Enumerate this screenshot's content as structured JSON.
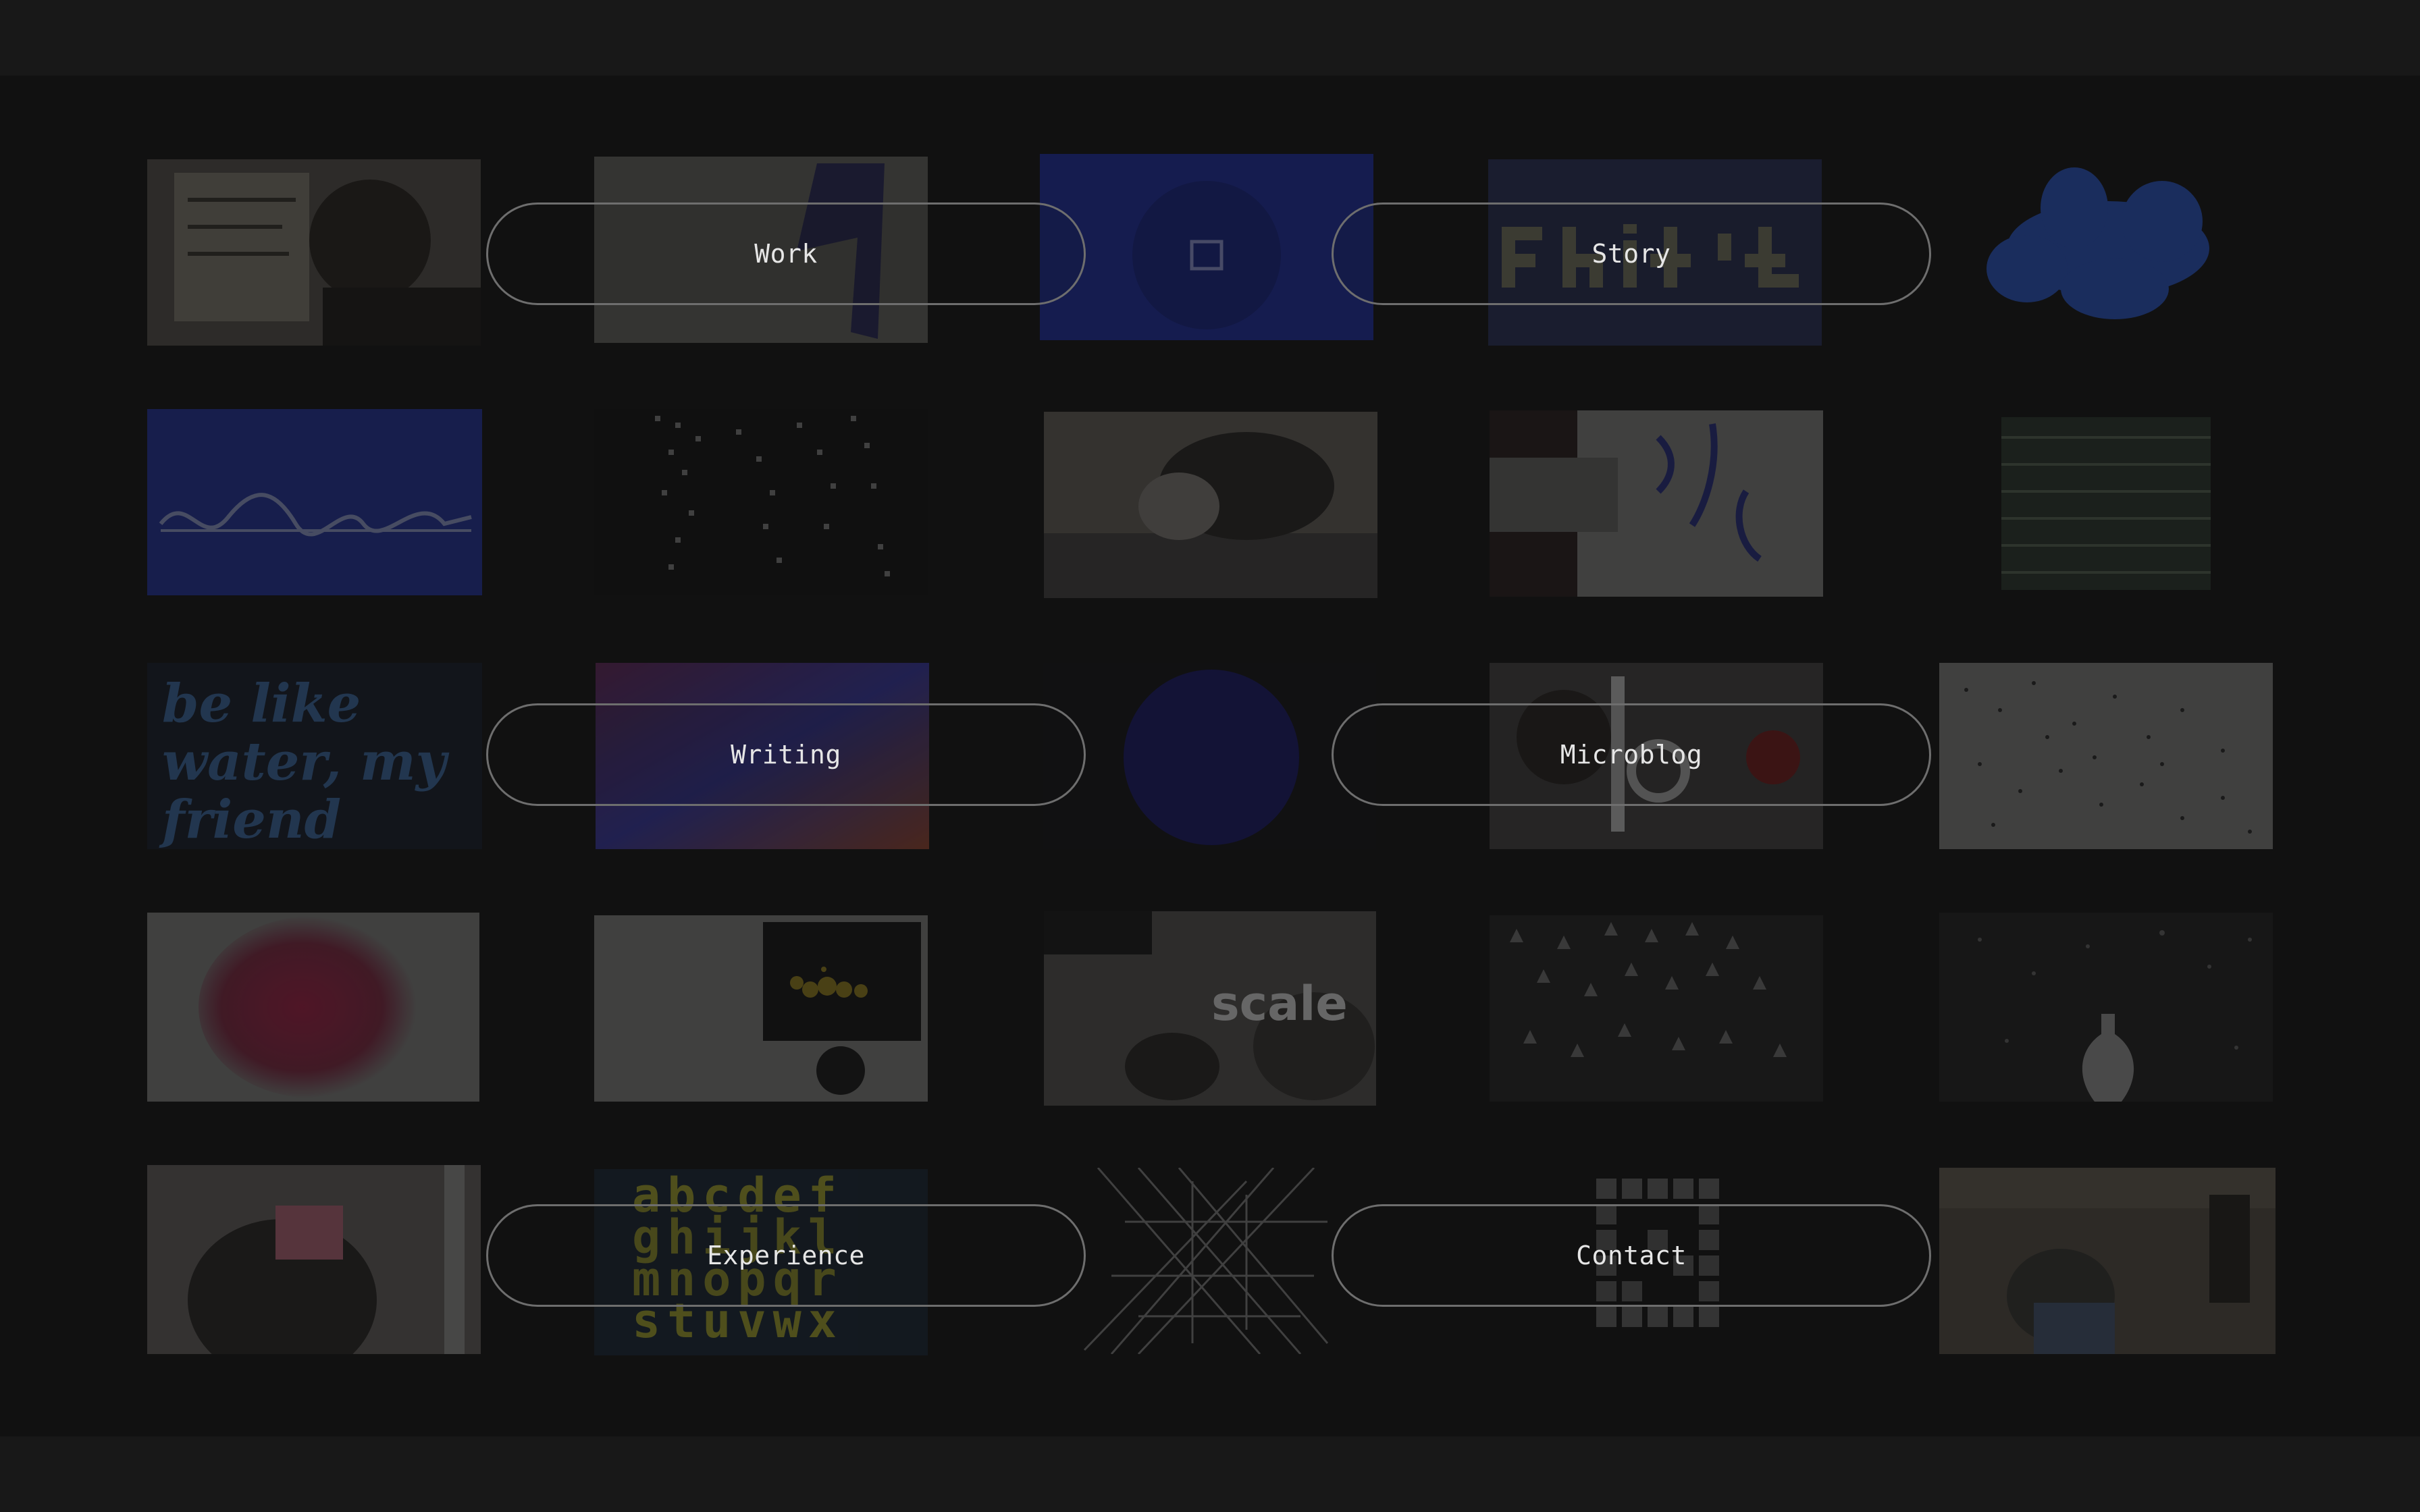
{
  "nav": {
    "work": "Work",
    "story": "Story",
    "writing": "Writing",
    "microblog": "Microblog",
    "experience": "Experience",
    "contact": "Contact"
  },
  "tiles": {
    "water_text": "be like\nwater, my\nfriend",
    "scale_text": "scale",
    "alphabet_text": "abcdef\nghijkl\nmnopqr\nstuvwx"
  },
  "colors": {
    "background": "#121212",
    "pill_border": "#6e6e6e",
    "pill_text": "#e6e6e6",
    "accent_blue": "#2f46c8"
  }
}
